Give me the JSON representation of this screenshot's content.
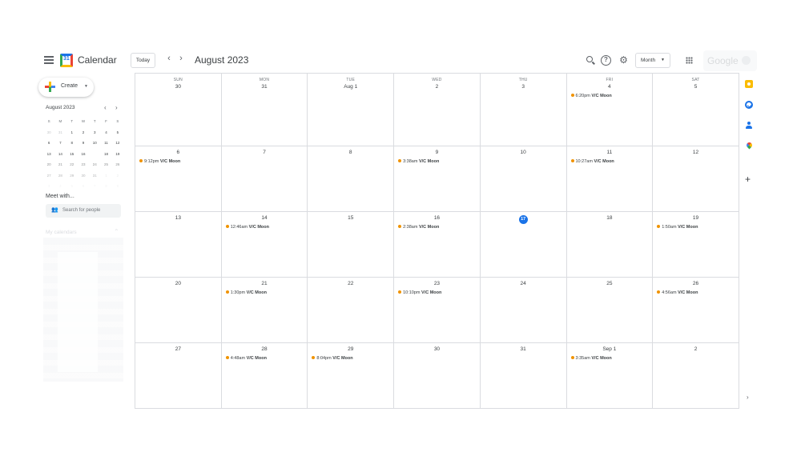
{
  "header": {
    "app_title": "Calendar",
    "logo_day": "31",
    "today_label": "Today",
    "prev_icon": "‹",
    "next_icon": "›",
    "month_title": "August 2023",
    "help_glyph": "?",
    "gear_glyph": "⚙",
    "view_label": "Month",
    "view_caret": "▼",
    "account_text": "Google"
  },
  "sidebar": {
    "create_label": "Create",
    "create_caret": "▼",
    "mini_title": "August 2023",
    "mini_prev": "‹",
    "mini_next": "›",
    "mini_dow": [
      "S",
      "M",
      "T",
      "W",
      "T",
      "F",
      "S"
    ],
    "mini_weeks": [
      [
        "30",
        "31",
        "1",
        "2",
        "3",
        "4",
        "5"
      ],
      [
        "6",
        "7",
        "8",
        "9",
        "10",
        "11",
        "12"
      ],
      [
        "13",
        "14",
        "15",
        "16",
        "17",
        "18",
        "19"
      ],
      [
        "20",
        "21",
        "22",
        "23",
        "24",
        "25",
        "26"
      ],
      [
        "27",
        "28",
        "29",
        "30",
        "31",
        "1",
        "2"
      ],
      [
        "3",
        "4",
        "5",
        "6",
        "7",
        "8",
        "9"
      ]
    ],
    "mini_selected": "17",
    "meet_title": "Meet with...",
    "people_icon": "👥",
    "people_placeholder": "Search for people",
    "my_calendars_title": "My calendars",
    "my_calendars_caret": "⌃"
  },
  "calendar": {
    "weekdays": [
      "SUN",
      "MON",
      "TUE",
      "WED",
      "THU",
      "FRI",
      "SAT"
    ],
    "today": "17",
    "event_color": "#f09300",
    "weeks": [
      [
        {
          "day": "30",
          "events": []
        },
        {
          "day": "31",
          "events": []
        },
        {
          "day": "Aug 1",
          "events": []
        },
        {
          "day": "2",
          "events": []
        },
        {
          "day": "3",
          "events": []
        },
        {
          "day": "4",
          "events": [
            {
              "time": "6:20pm",
              "title": "V/C Moon"
            }
          ]
        },
        {
          "day": "5",
          "events": []
        }
      ],
      [
        {
          "day": "6",
          "events": [
            {
              "time": "9:12pm",
              "title": "V/C Moon"
            }
          ]
        },
        {
          "day": "7",
          "events": []
        },
        {
          "day": "8",
          "events": []
        },
        {
          "day": "9",
          "events": [
            {
              "time": "3:38am",
              "title": "V/C Moon"
            }
          ]
        },
        {
          "day": "10",
          "events": []
        },
        {
          "day": "11",
          "events": [
            {
              "time": "10:27am",
              "title": "V/C Moon"
            }
          ]
        },
        {
          "day": "12",
          "events": []
        }
      ],
      [
        {
          "day": "13",
          "events": []
        },
        {
          "day": "14",
          "events": [
            {
              "time": "12:46am",
              "title": "V/C Moon"
            }
          ]
        },
        {
          "day": "15",
          "events": []
        },
        {
          "day": "16",
          "events": [
            {
              "time": "2:38am",
              "title": "V/C Moon"
            }
          ]
        },
        {
          "day": "17",
          "events": []
        },
        {
          "day": "18",
          "events": []
        },
        {
          "day": "19",
          "events": [
            {
              "time": "1:50am",
              "title": "V/C Moon"
            }
          ]
        }
      ],
      [
        {
          "day": "20",
          "events": []
        },
        {
          "day": "21",
          "events": [
            {
              "time": "1:30pm",
              "title": "V/C Moon"
            }
          ]
        },
        {
          "day": "22",
          "events": []
        },
        {
          "day": "23",
          "events": [
            {
              "time": "10:10pm",
              "title": "V/C Moon"
            }
          ]
        },
        {
          "day": "24",
          "events": []
        },
        {
          "day": "25",
          "events": []
        },
        {
          "day": "26",
          "events": [
            {
              "time": "4:56am",
              "title": "V/C Moon"
            }
          ]
        }
      ],
      [
        {
          "day": "27",
          "events": []
        },
        {
          "day": "28",
          "events": [
            {
              "time": "4:48am",
              "title": "V/C Moon"
            }
          ]
        },
        {
          "day": "29",
          "events": [
            {
              "time": "8:04pm",
              "title": "V/C Moon"
            }
          ]
        },
        {
          "day": "30",
          "events": []
        },
        {
          "day": "31",
          "events": []
        },
        {
          "day": "Sep 1",
          "events": [
            {
              "time": "3:35am",
              "title": "V/C Moon"
            }
          ]
        },
        {
          "day": "2",
          "events": []
        }
      ]
    ]
  },
  "side_panel": {
    "add_glyph": "+",
    "expand_glyph": "›",
    "icons": [
      "keep-icon",
      "tasks-icon",
      "contacts-icon",
      "maps-icon"
    ]
  }
}
